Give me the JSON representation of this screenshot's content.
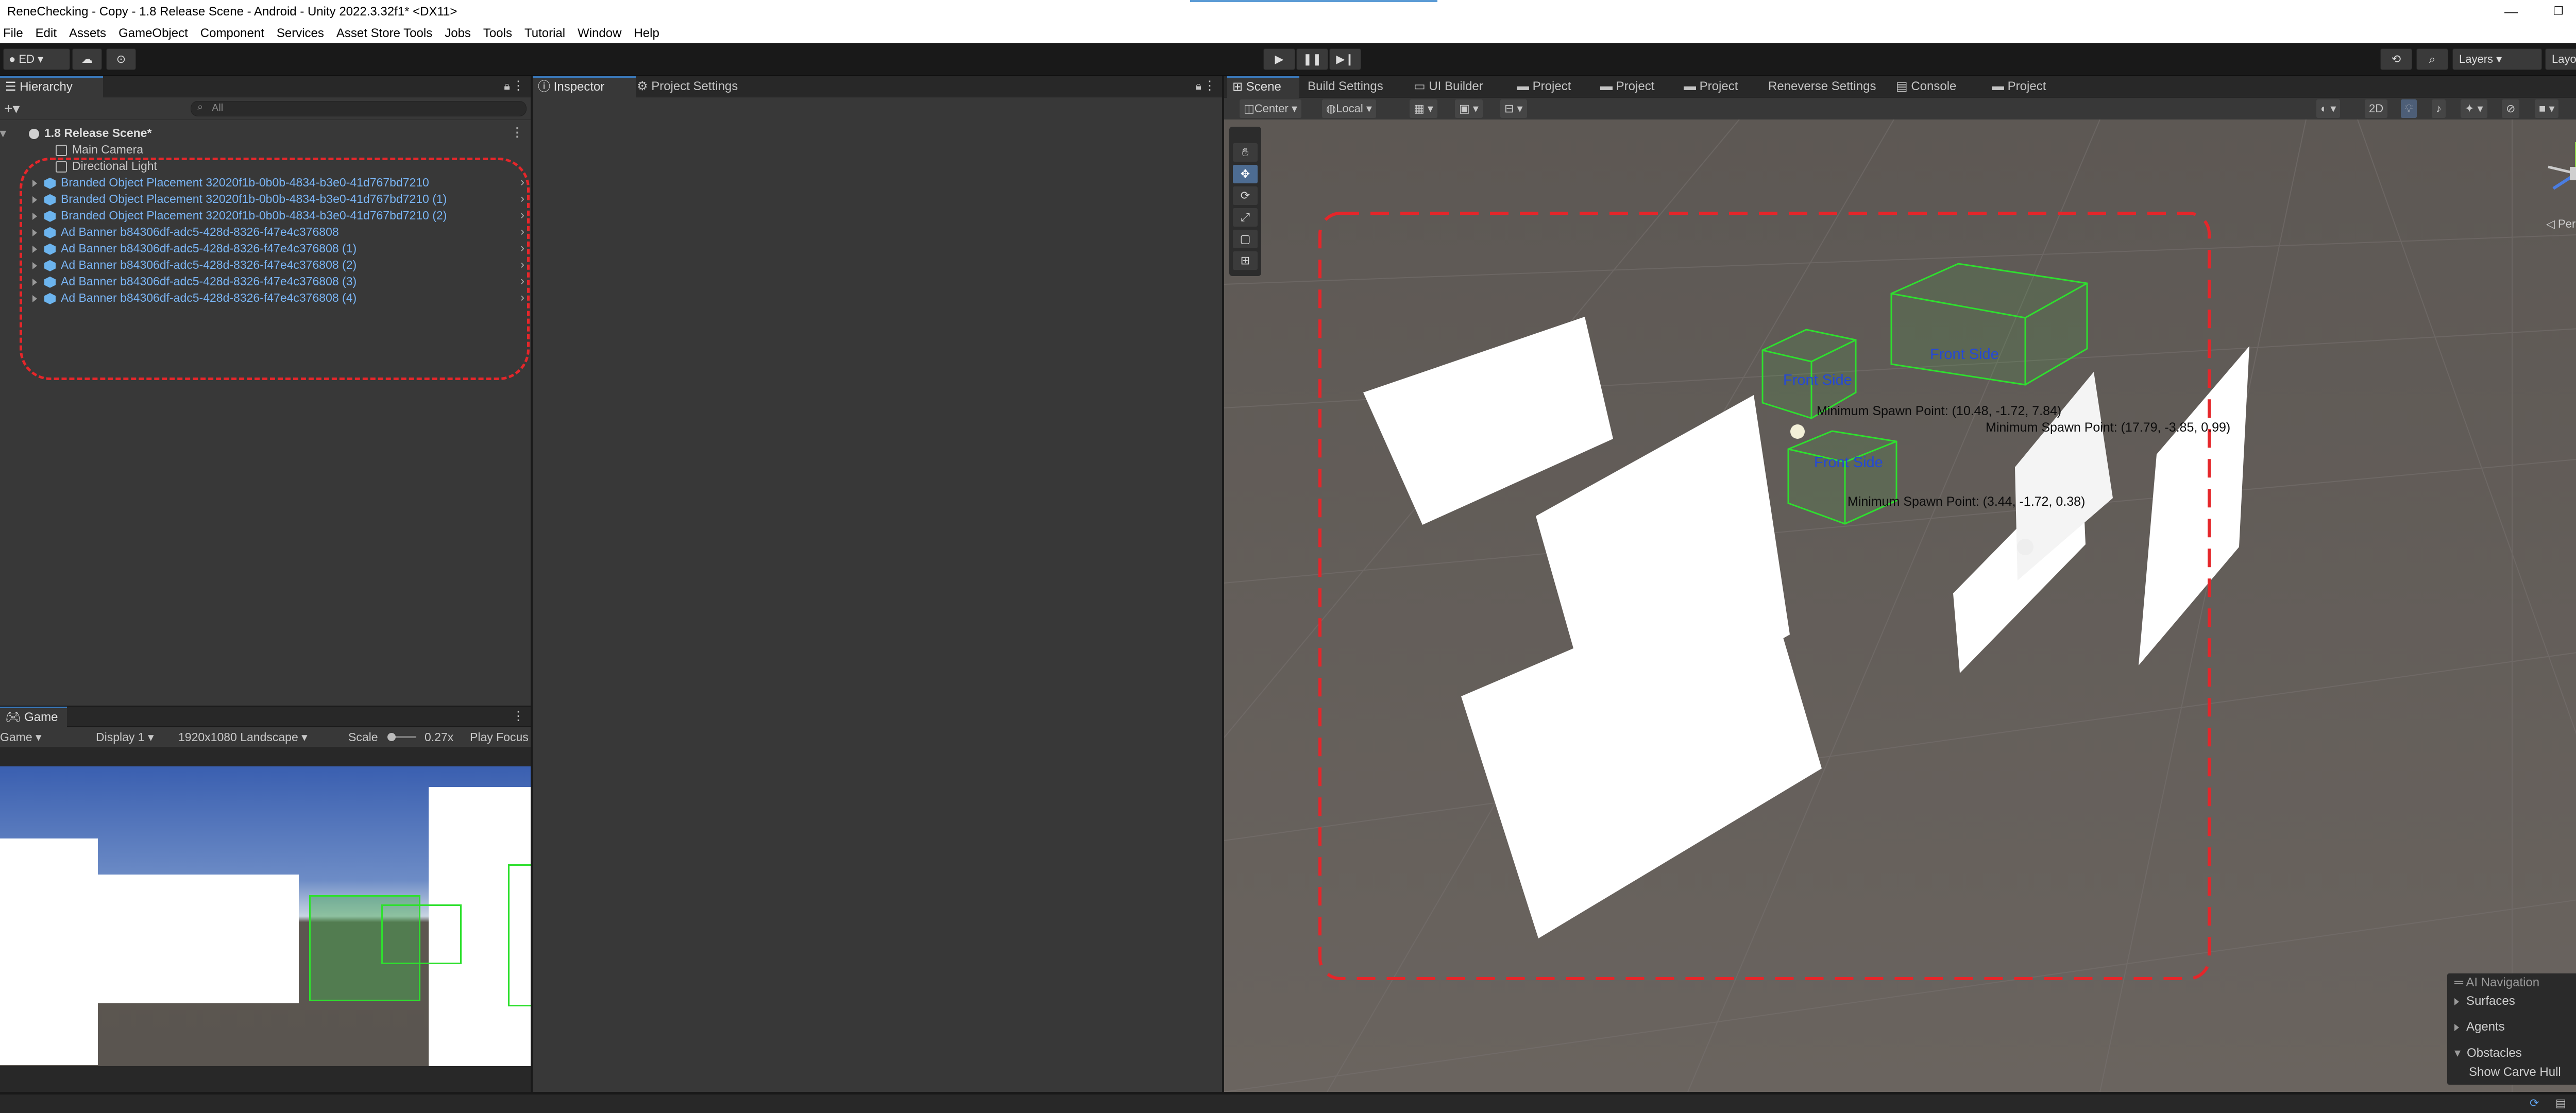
{
  "window": {
    "title": "ReneChecking - Copy - 1.8 Release Scene - Android - Unity 2022.3.32f1* <DX11>",
    "minimize": "—",
    "maximize": "❐",
    "close": "✕"
  },
  "menu": [
    "File",
    "Edit",
    "Assets",
    "GameObject",
    "Component",
    "Services",
    "Asset Store Tools",
    "Jobs",
    "Tools",
    "Tutorial",
    "Window",
    "Help"
  ],
  "toolbar": {
    "account": "ED",
    "play_icon": "play-icon",
    "pause_icon": "pause-icon",
    "step_icon": "step-icon",
    "layers": "Layers",
    "layout": "Layout"
  },
  "hierarchy": {
    "tab": "Hierarchy",
    "search_placeholder": "All",
    "scene": "1.8 Release Scene*",
    "items": [
      {
        "label": "Main Camera",
        "type": "gameobject"
      },
      {
        "label": "Directional Light",
        "type": "gameobject"
      },
      {
        "label": "Branded Object Placement 32020f1b-0b0b-4834-b3e0-41d767bd7210",
        "type": "prefab"
      },
      {
        "label": "Branded Object Placement 32020f1b-0b0b-4834-b3e0-41d767bd7210 (1)",
        "type": "prefab"
      },
      {
        "label": "Branded Object Placement 32020f1b-0b0b-4834-b3e0-41d767bd7210 (2)",
        "type": "prefab"
      },
      {
        "label": "Ad Banner b84306df-adc5-428d-8326-f47e4c376808",
        "type": "prefab"
      },
      {
        "label": "Ad Banner b84306df-adc5-428d-8326-f47e4c376808 (1)",
        "type": "prefab"
      },
      {
        "label": "Ad Banner b84306df-adc5-428d-8326-f47e4c376808 (2)",
        "type": "prefab"
      },
      {
        "label": "Ad Banner b84306df-adc5-428d-8326-f47e4c376808 (3)",
        "type": "prefab"
      },
      {
        "label": "Ad Banner b84306df-adc5-428d-8326-f47e4c376808 (4)",
        "type": "prefab"
      }
    ]
  },
  "inspector_tabs": [
    "Inspector",
    "Project Settings"
  ],
  "scene_tabs": [
    "Scene",
    "Build Settings",
    "UI Builder",
    "Project",
    "Project",
    "Project",
    "Reneverse Settings",
    "Console",
    "Project"
  ],
  "scene_toolbar": {
    "pivot": "Center",
    "space": "Local",
    "mode2d": "2D",
    "persp": "Persp"
  },
  "scene_labels": {
    "front_side": "Front Side",
    "min_spawn_1": "Minimum Spawn Point: (10.48, -1.72, 7.84)",
    "min_spawn_2": "Minimum Spawn Point: (17.79, -3.85, 0.99)",
    "min_spawn_3": "Minimum Spawn Point: (3.44, -1.72, 0.38)"
  },
  "ai_navigation": {
    "title": "AI Navigation",
    "items": [
      "Surfaces",
      "Agents",
      "Obstacles"
    ],
    "option": "Show Carve Hull"
  },
  "game": {
    "tab": "Game",
    "view": "Game",
    "display": "Display 1",
    "resolution": "1920x1080 Landscape",
    "scale_label": "Scale",
    "scale_value": "0.27x",
    "play_focus": "Play Focus"
  },
  "colors": {
    "highlight": "#e5262a",
    "prefab": "#7ab5f5",
    "gizmo": "#2ee02e",
    "accent": "#3a79bb"
  }
}
